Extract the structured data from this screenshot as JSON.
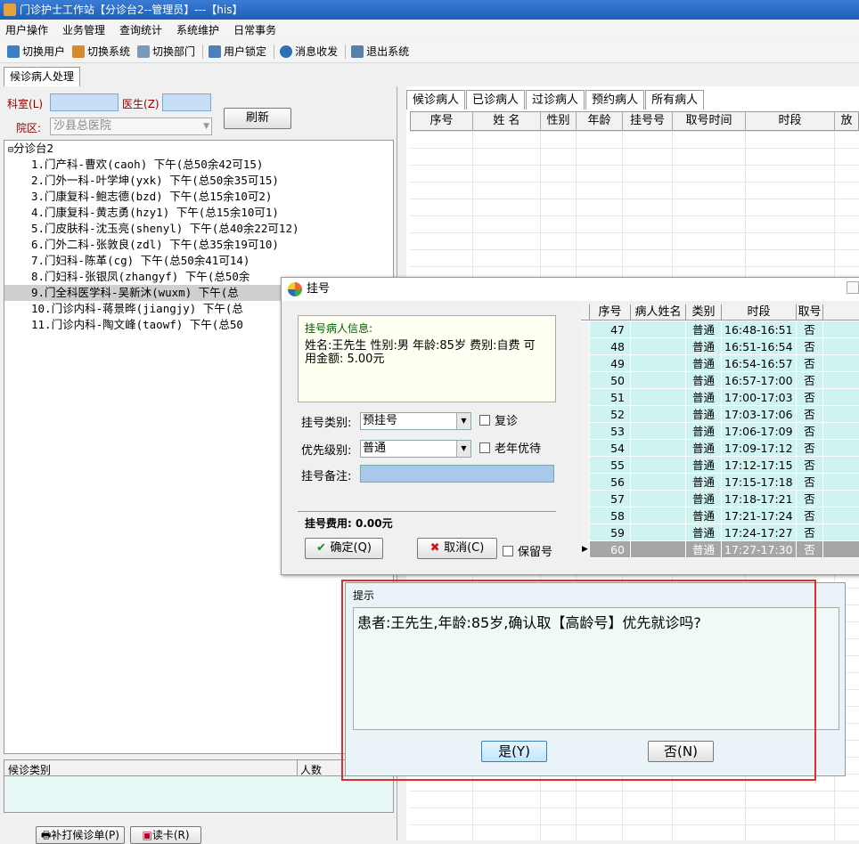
{
  "window": {
    "title": "门诊护士工作站【分诊台2--管理员】---【his】"
  },
  "menu": [
    "用户操作",
    "业务管理",
    "查询统计",
    "系统维护",
    "日常事务"
  ],
  "toolbar": {
    "switch_user": "切换用户",
    "switch_system": "切换系统",
    "switch_dept": "切换部门",
    "lock_user": "用户锁定",
    "messages": "消息收发",
    "exit": "退出系统"
  },
  "main_tab": "候诊病人处理",
  "left": {
    "dept_label": "科室",
    "dept_key": "(L)",
    "doctor_label": "医生",
    "doctor_key": "(Z)",
    "hospital_label": "院区:",
    "hospital_value": "沙县总医院",
    "refresh": "刷新",
    "tree_root": "分诊台2",
    "tree_items": [
      "1.门产科-曹欢(caoh) 下午(总50余42可15)",
      "2.门外一科-叶学坤(yxk) 下午(总50余35可15)",
      "3.门康复科-鲍志德(bzd) 下午(总15余10可2)",
      "4.门康复科-黄志勇(hzy1) 下午(总15余10可1)",
      "5.门皮肤科-沈玉亮(shenyl) 下午(总40余22可12)",
      "6.门外二科-张敦良(zdl) 下午(总35余19可10)",
      "7.门妇科-陈革(cg) 下午(总50余41可14)",
      "8.门妇科-张银凤(zhangyf) 下午(总50余",
      "9.门全科医学科-吴新沐(wuxm) 下午(总",
      "10.门诊内科-蒋景晔(jiangjy) 下午(总",
      "11.门诊内科-陶文峰(taowf) 下午(总50"
    ],
    "bottom_col1": "候诊类别",
    "bottom_col2": "人数",
    "reprint": "补打候诊单(P)",
    "read_card": "读卡(R)"
  },
  "right": {
    "tabs": [
      "候诊病人",
      "已诊病人",
      "过诊病人",
      "预约病人",
      "所有病人"
    ],
    "columns": [
      "序号",
      "姓 名",
      "性别",
      "年龄",
      "挂号号",
      "取号时间",
      "时段",
      "放"
    ]
  },
  "reg_dialog": {
    "title": "挂号",
    "info_caption": "挂号病人信息:",
    "info_text": "姓名:王先生 性别:男 年龄:85岁 费别:自费 可用金额: 5.00元",
    "type_label": "挂号类别:",
    "type_value": "预挂号",
    "revisit": "复诊",
    "priority_label": "优先级别:",
    "priority_value": "普通",
    "elder": "老年优待",
    "remark_label": "挂号备注:",
    "fee_label": "挂号费用: 0.00元",
    "ok": "确定(Q)",
    "cancel": "取消(C)",
    "keep": "保留号",
    "grid_cols": [
      "序号",
      "病人姓名",
      "类别",
      "时段",
      "取号"
    ],
    "rows": [
      [
        "47",
        "",
        "普通",
        "16:48-16:51",
        "否"
      ],
      [
        "48",
        "",
        "普通",
        "16:51-16:54",
        "否"
      ],
      [
        "49",
        "",
        "普通",
        "16:54-16:57",
        "否"
      ],
      [
        "50",
        "",
        "普通",
        "16:57-17:00",
        "否"
      ],
      [
        "51",
        "",
        "普通",
        "17:00-17:03",
        "否"
      ],
      [
        "52",
        "",
        "普通",
        "17:03-17:06",
        "否"
      ],
      [
        "53",
        "",
        "普通",
        "17:06-17:09",
        "否"
      ],
      [
        "54",
        "",
        "普通",
        "17:09-17:12",
        "否"
      ],
      [
        "55",
        "",
        "普通",
        "17:12-17:15",
        "否"
      ],
      [
        "56",
        "",
        "普通",
        "17:15-17:18",
        "否"
      ],
      [
        "57",
        "",
        "普通",
        "17:18-17:21",
        "否"
      ],
      [
        "58",
        "",
        "普通",
        "17:21-17:24",
        "否"
      ],
      [
        "59",
        "",
        "普通",
        "17:24-17:27",
        "否"
      ],
      [
        "60",
        "",
        "普通",
        "17:27-17:30",
        "否"
      ]
    ]
  },
  "prompt": {
    "title": "提示",
    "message": "患者:王先生,年龄:85岁,确认取【高龄号】优先就诊吗?",
    "yes": "是(Y)",
    "no": "否(N)"
  }
}
